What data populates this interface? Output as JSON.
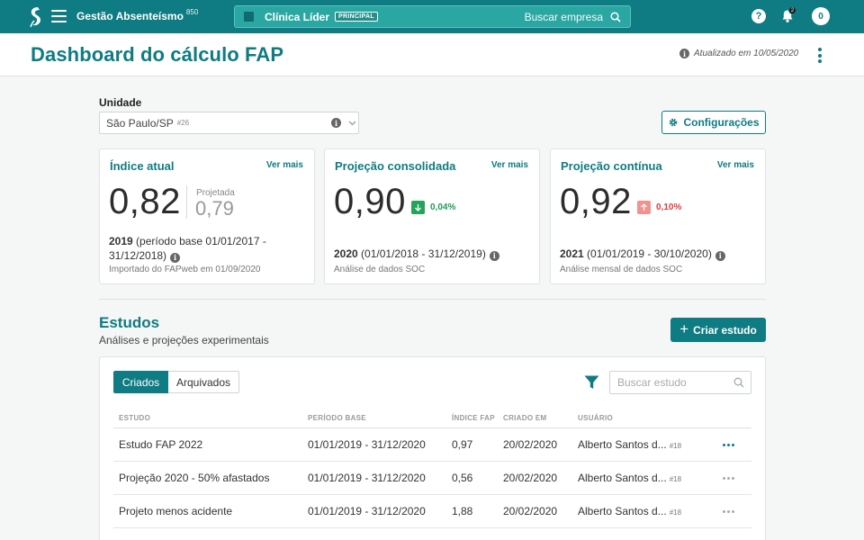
{
  "topbar": {
    "app_title": "Gestão Absenteísmo",
    "app_code": "850",
    "company_name": "Clínica Líder",
    "company_badge": "PRINCIPAL",
    "company_search": "Buscar empresa",
    "help_label": "?",
    "notifications_count": "2",
    "user_badge": "0"
  },
  "header": {
    "title": "Dashboard do cálculo FAP",
    "updated": "Atualizado em 10/05/2020"
  },
  "unit": {
    "label": "Unidade",
    "value": "São Paulo/SP",
    "code": "#26",
    "info": "i"
  },
  "config_button": "Configurações",
  "cards": [
    {
      "title": "Índice atual",
      "link": "Ver mais",
      "value": "0,82",
      "projected_label": "Projetada",
      "projected_value": "0,79",
      "year": "2019",
      "period": "(período base 01/01/2017 - 31/12/2018)",
      "source": "Importado do FAPweb em 01/09/2020"
    },
    {
      "title": "Projeção consolidada",
      "link": "Ver mais",
      "value": "0,90",
      "delta": "0,04%",
      "delta_direction": "down",
      "year": "2020",
      "period": "(01/01/2018 - 31/12/2019)",
      "source": "Análise de dados SOC"
    },
    {
      "title": "Projeção contínua",
      "link": "Ver mais",
      "value": "0,92",
      "delta": "0,10%",
      "delta_direction": "up",
      "year": "2021",
      "period": "(01/01/2019 - 30/10/2020)",
      "source": "Análise mensal de dados SOC"
    }
  ],
  "estudos": {
    "title": "Estudos",
    "subtitle": "Análises e projeções experimentais",
    "create_button": "Criar estudo",
    "tabs": [
      "Criados",
      "Arquivados"
    ],
    "search_placeholder": "Buscar estudo",
    "columns": [
      "ESTUDO",
      "PERÍODO BASE",
      "ÍNDICE FAP",
      "CRIADO EM",
      "USUÁRIO"
    ],
    "rows": [
      {
        "name": "Estudo FAP 2022",
        "period": "01/01/2019 - 31/12/2020",
        "index": "0,97",
        "created": "20/02/2020",
        "user": "Alberto Santos d...",
        "user_id": "#18"
      },
      {
        "name": "Projeção 2020 - 50% afastados",
        "period": "01/01/2019 - 31/12/2020",
        "index": "0,56",
        "created": "20/02/2020",
        "user": "Alberto Santos d...",
        "user_id": "#18"
      },
      {
        "name": "Projeto menos acidente",
        "period": "01/01/2019 - 31/12/2020",
        "index": "1,88",
        "created": "20/02/2020",
        "user": "Alberto Santos d...",
        "user_id": "#18"
      }
    ]
  },
  "colors": {
    "brand": "#0f7b82",
    "positive": "#24a35b",
    "negative": "#e03b3b"
  }
}
